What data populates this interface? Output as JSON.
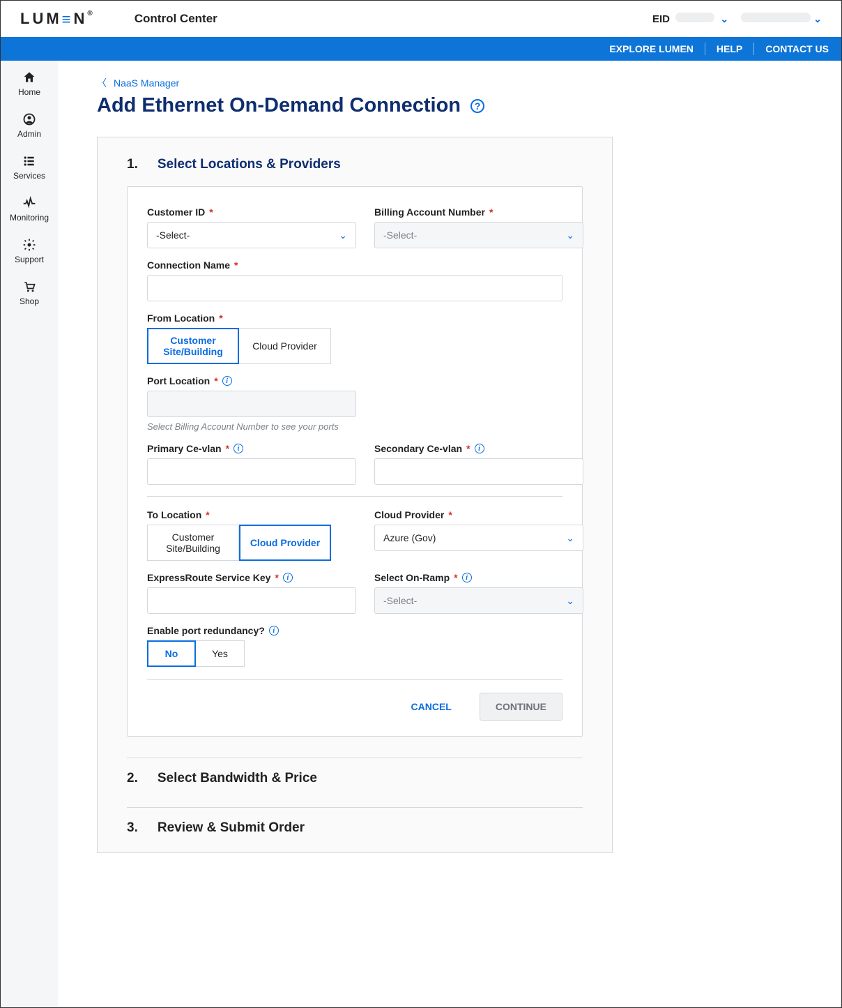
{
  "header": {
    "brand": "LUMEN",
    "brand_tm": "®",
    "product": "Control Center",
    "eid_label": "EID"
  },
  "bluebar": {
    "explore": "EXPLORE LUMEN",
    "help": "HELP",
    "contact": "CONTACT US"
  },
  "sidebar": [
    {
      "label": "Home"
    },
    {
      "label": "Admin"
    },
    {
      "label": "Services"
    },
    {
      "label": "Monitoring"
    },
    {
      "label": "Support"
    },
    {
      "label": "Shop"
    }
  ],
  "breadcrumb": {
    "parent": "NaaS Manager"
  },
  "page_title": "Add Ethernet On-Demand Connection",
  "steps": {
    "s1_num": "1.",
    "s1_title": "Select Locations & Providers",
    "s2_num": "2.",
    "s2_title": "Select Bandwidth & Price",
    "s3_num": "3.",
    "s3_title": "Review & Submit Order"
  },
  "form": {
    "customer_id": {
      "label": "Customer ID",
      "placeholder": "-Select-"
    },
    "ban": {
      "label": "Billing Account Number",
      "placeholder": "-Select-"
    },
    "conn_name": {
      "label": "Connection Name"
    },
    "from_loc": {
      "label": "From Location",
      "opt_customer": "Customer Site/Building",
      "opt_cloud": "Cloud Provider",
      "selected": "customer"
    },
    "port_loc": {
      "label": "Port Location",
      "hint": "Select Billing Account Number to see your ports"
    },
    "primary_cevlan": {
      "label": "Primary Ce-vlan"
    },
    "secondary_cevlan": {
      "label": "Secondary Ce-vlan"
    },
    "to_loc": {
      "label": "To Location",
      "opt_customer": "Customer Site/Building",
      "opt_cloud": "Cloud Provider",
      "selected": "cloud"
    },
    "cloud_provider": {
      "label": "Cloud Provider",
      "value": "Azure (Gov)"
    },
    "exp_route": {
      "label": "ExpressRoute Service Key"
    },
    "onramp": {
      "label": "Select On-Ramp",
      "placeholder": "-Select-"
    },
    "redundancy": {
      "label": "Enable port redundancy?",
      "opt_no": "No",
      "opt_yes": "Yes",
      "selected": "no"
    }
  },
  "actions": {
    "cancel": "CANCEL",
    "continue": "CONTINUE"
  }
}
